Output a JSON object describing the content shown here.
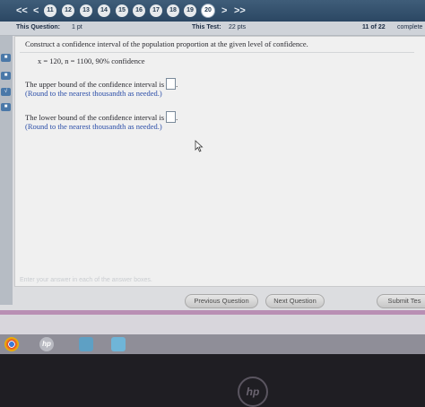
{
  "nav": {
    "first": "<<",
    "prev": "<",
    "next": ">",
    "last": ">>",
    "questions": [
      "11",
      "12",
      "13",
      "14",
      "15",
      "16",
      "17",
      "18",
      "19",
      "20"
    ],
    "current": "20"
  },
  "info": {
    "this_question_label": "This Question:",
    "this_question_pts": "1 pt",
    "this_test_label": "This Test:",
    "this_test_pts": "22 pts",
    "progress": "11 of 22",
    "complete": "complete"
  },
  "question": {
    "prompt": "Construct a confidence interval of the population proportion at the given level of confidence.",
    "given": "x = 120, n = 1100, 90% confidence",
    "upper_text": "The upper bound of the confidence interval is",
    "upper_hint": "(Round to the nearest thousandth as needed.)",
    "lower_text": "The lower bound of the confidence interval is",
    "lower_hint": "(Round to the nearest thousandth as needed.)",
    "period": "."
  },
  "footer": {
    "hint": "Enter your answer in each of the answer boxes.",
    "previous": "Previous Question",
    "next": "Next Question",
    "submit": "Submit Tes"
  },
  "taskbar": {
    "icons": [
      "chrome-icon",
      "hp-icon",
      "cloud-icon",
      "photos-icon"
    ]
  },
  "bezel": {
    "logo": "hp"
  },
  "colors": {
    "nav_bg": "#3f5d79",
    "link_blue": "#2b4ea8",
    "accent_pink": "#b98fb4"
  }
}
